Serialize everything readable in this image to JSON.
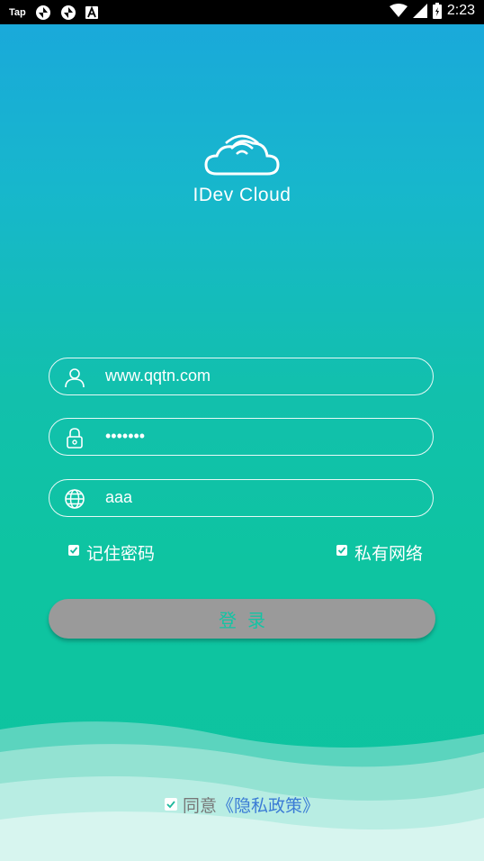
{
  "status_bar": {
    "app_label": "Tap",
    "time": "2:23",
    "icons": [
      "tap-logo-icon",
      "sync-icon",
      "sync-icon",
      "font-a-icon",
      "wifi-icon",
      "signal-icon",
      "battery-icon"
    ]
  },
  "logo": {
    "title": "IDev Cloud",
    "icon": "cloud-wifi-icon"
  },
  "form": {
    "username_value": "www.qqtn.com",
    "password_value": "aaaaaaa",
    "server_value": "aaa",
    "remember_label": "记住密码",
    "remember_checked": true,
    "private_label": "私有网络",
    "private_checked": true,
    "login_label": "登录"
  },
  "footer": {
    "agree_label": "同意",
    "policy_label": "《隐私政策》",
    "agree_checked": true
  },
  "colors": {
    "gradient_top": "#1aa7dc",
    "gradient_bottom": "#0dc39f",
    "button_bg": "#9a9a9a",
    "button_text": "#14c4a4",
    "policy_link": "#3a7bd5"
  }
}
